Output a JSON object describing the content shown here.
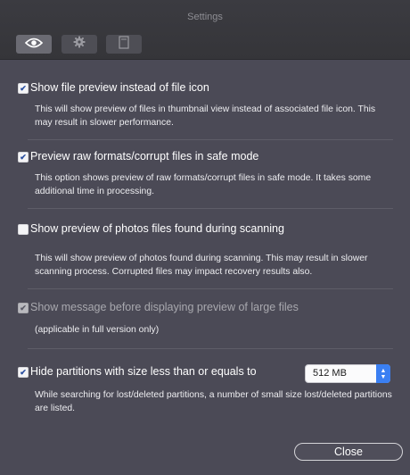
{
  "window": {
    "title": "Settings"
  },
  "tabs": [
    {
      "icon": "eye-icon",
      "active": true
    },
    {
      "icon": "gear-icon",
      "active": false
    },
    {
      "icon": "document-icon",
      "active": false
    }
  ],
  "options": {
    "file_preview": {
      "checked": true,
      "label": "Show file preview instead of file icon",
      "desc": "This will show preview of files in thumbnail view instead of associated file icon. This may result in slower performance."
    },
    "raw_preview": {
      "checked": true,
      "label": "Preview raw formats/corrupt files in safe mode",
      "desc": "This option shows preview of raw formats/corrupt files in safe mode. It takes some additional time in processing."
    },
    "photos_preview": {
      "checked": false,
      "label": "Show preview of photos files found during scanning",
      "desc": "This will show preview of photos found during scanning. This may result in slower scanning process. Corrupted files may impact recovery results also."
    },
    "large_files_message": {
      "checked": true,
      "disabled": true,
      "label": "Show message before displaying preview of large files",
      "desc": "(applicable in full version only)"
    },
    "hide_partitions": {
      "checked": true,
      "label": "Hide partitions with size less than or equals to",
      "select_value": "512 MB",
      "desc": "While searching for lost/deleted partitions, a number of small size lost/deleted partitions are listed."
    }
  },
  "buttons": {
    "close_label": "Close"
  },
  "colors": {
    "accent": "#3a7ff2",
    "background": "#4b4a56",
    "titlebar": "#38383d"
  }
}
